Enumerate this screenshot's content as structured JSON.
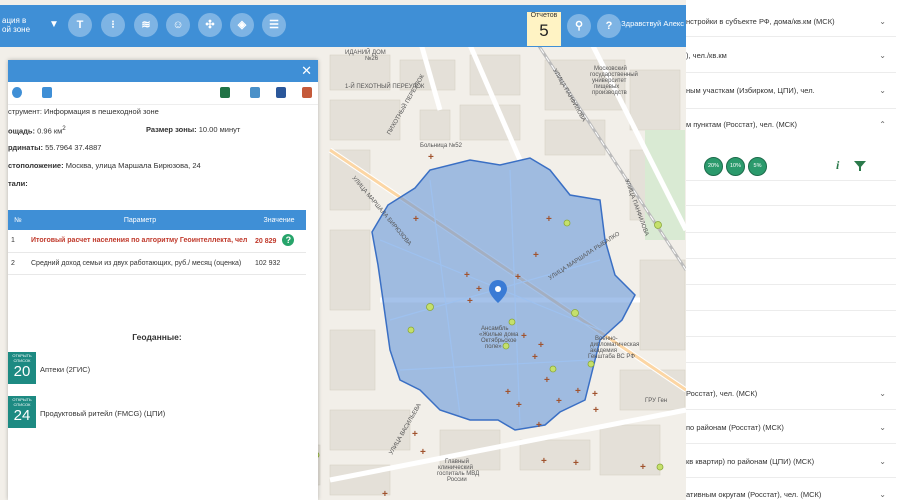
{
  "colors": {
    "accent": "#3f8fd6",
    "zone_fill": "#5b8fd8",
    "zone_stroke": "#3a6fc4",
    "marker": "#c0392b",
    "teal": "#1d8a82",
    "green": "#2b9a6c"
  },
  "toolbar": {
    "title": "ация в\nой зоне",
    "reports_label": "Отчетов",
    "reports_count": "5",
    "greeting": "Здравствуй\nАлекс",
    "buttons": [
      "text-tool",
      "traffic-light",
      "layers-stack",
      "people",
      "compass",
      "layers",
      "sliders"
    ],
    "search_icon": "search-icon",
    "help_label": "?"
  },
  "panel": {
    "instrument": "струмент: Информация в пешеходной зоне",
    "area_label": "ощадь:",
    "area_value": "0.96 км",
    "area_sup": "2",
    "zone_label": "Размер зоны:",
    "zone_value": "10.00 минут",
    "coords_label": "рдинаты:",
    "coords_value": "55.7964  37.4887",
    "location_label": "стоположение:",
    "location_value": "Москва, улица Маршала Бирюзова, 24",
    "details_label": "тали:",
    "table": {
      "headers": [
        "№",
        "Параметр",
        "Значение"
      ],
      "rows": [
        {
          "num": "1",
          "param": "Итоговый расчет населения по алгоритму Геоинтеллекта, чел",
          "value": "20 829"
        },
        {
          "num": "2",
          "param": "Средний доход семьи из двух работающих, руб./ месяц (оценка)",
          "value": "102 932"
        }
      ]
    },
    "geodata_title": "Геоданные:",
    "geodata": [
      {
        "badge_top": "ОТКРЫТЬ СПИСОК",
        "count": "20",
        "label": "Аптеки (2ГИС)"
      },
      {
        "badge_top": "ОТКРЫТЬ СПИСОК",
        "count": "24",
        "label": "Продуктовый ритейл (FMCG) (ЦПИ)"
      }
    ]
  },
  "map": {
    "streets": [
      "УЛИЦА МАРШАЛА БИРЮЗОВА",
      "УЛИЦА МАРШАЛА РЫБАЛКО",
      "УЛИЦА ПАНФИЛОВА",
      "ПИХОТНЫЙ ПЕРЕУЛОК",
      "1-Й ПЕХОТНЫЙ ПЕРЕУЛОК",
      "УЛИЦА ПАРШИНА",
      "УЛИЦА БЕРЗАРИНА",
      "УЛИЦА ВАСИЛЬЕВА",
      "ПЕХОТНЫЙ ПЕРЕУЛОК",
      "УЛИЦА ПАНФИЛОВА"
    ],
    "pois": [
      "Больница №52",
      "Московский государственный университет пищевых производств",
      "Военно-дипломатическая академия Генштаба ВС РФ",
      "Главный клинический госпиталь МВД России",
      "Ансамбль «Жилые дома Октябрьское поле»",
      "ИДАНИЙ ДОМ №26",
      "ГРУ Ген"
    ]
  },
  "right_panel": {
    "rows": [
      "нстройки в субъекте РФ, дома/кв.км (МСК)",
      "), чел./кв.км",
      "ным участкам (Избирком, ЦПИ), чел.",
      "м пунктам (Росстат), чел. (МСК)",
      "Росстат), чел. (МСК)",
      "по районам (Росстат) (МСК)",
      "кв квартир) по районам (ЦПИ) (МСК)",
      "ативным округам (Росстат), чел. (МСК)"
    ],
    "percents": [
      "20%",
      "10%",
      "5%"
    ],
    "info_icon": "i",
    "filter_icon": "filter-icon"
  }
}
